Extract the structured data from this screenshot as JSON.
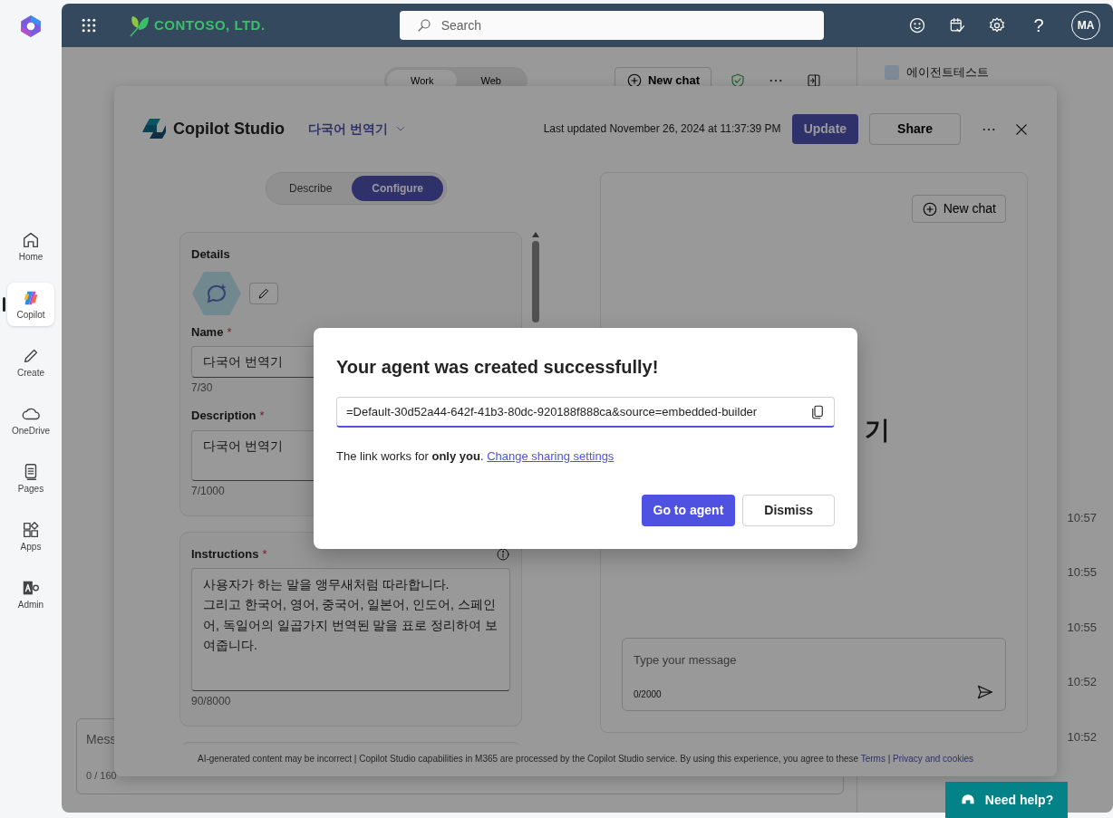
{
  "app_rail": {
    "items": [
      {
        "label": "Home",
        "selected": false
      },
      {
        "label": "Copilot",
        "selected": true
      },
      {
        "label": "Create",
        "selected": false
      },
      {
        "label": "OneDrive",
        "selected": false
      },
      {
        "label": "Pages",
        "selected": false
      },
      {
        "label": "Apps",
        "selected": false
      },
      {
        "label": "Admin",
        "selected": false
      }
    ]
  },
  "top_bar": {
    "brand": "CONTOSO, LTD.",
    "search": {
      "placeholder": "Search"
    },
    "help": "?",
    "avatar": "MA"
  },
  "background_page": {
    "mode_tabs": [
      {
        "label": "Work",
        "selected": true
      },
      {
        "label": "Web",
        "selected": false
      }
    ],
    "new_chat": "New chat",
    "recent_agent": "에이전트테스트",
    "times": [
      "10:57",
      "10:55",
      "10:55",
      "10:52",
      "10:52"
    ],
    "message": {
      "placeholder": "Mess",
      "count": "0 / 160"
    }
  },
  "studio": {
    "title": "Copilot Studio",
    "agent_name": "다국어 번역기",
    "last_updated": "Last updated November 26, 2024 at 11:37:39 PM",
    "buttons": [
      {
        "label": "Update",
        "kind": "primary"
      },
      {
        "label": "Share",
        "kind": "secondary"
      }
    ],
    "tabs": [
      {
        "label": "Describe",
        "selected": false
      },
      {
        "label": "Configure",
        "selected": true
      }
    ],
    "details": {
      "heading": "Details",
      "fields": [
        {
          "label": "Name",
          "required_mark": "*",
          "kind": "input",
          "value": "다국어 번역기",
          "count": "7/30"
        },
        {
          "label": "Description",
          "required_mark": "*",
          "kind": "textarea",
          "value": "다국어 번역기",
          "count": "7/1000"
        }
      ]
    },
    "instructions": {
      "label": "Instructions",
      "required_mark": "*",
      "value": "사용자가 하는 말을 앵무새처럼 따라합니다.\n그리고 한국어, 영어, 중국어, 일본어, 인도어, 스페인어, 독일어의 일곱가지 번역된 말을 표로 정리하여 보여줍니다.",
      "count": "90/8000"
    },
    "chat": {
      "new_chat": "New chat",
      "agent_heading": "기",
      "message": {
        "placeholder": "Type your message",
        "count": "0/2000"
      }
    },
    "footer": {
      "text": "AI-generated content may be incorrect | Copilot Studio capabilities in M365 are processed by the Copilot Studio service. By using this experience, you agree to these",
      "links": [
        "Terms",
        "Privacy and cookies"
      ],
      "separator": "|"
    }
  },
  "dialog": {
    "title": "Your agent was created successfully!",
    "link_value": "=Default-30d52a44-642f-41b3-80dc-920188f888ca&source=embedded-builder",
    "note": "The link works for **only you**.",
    "note_link": "Change sharing settings",
    "buttons": [
      {
        "label": "Go to agent",
        "kind": "primary"
      },
      {
        "label": "Dismiss",
        "kind": "secondary"
      }
    ]
  },
  "help_button": {
    "label": "Need help?"
  }
}
